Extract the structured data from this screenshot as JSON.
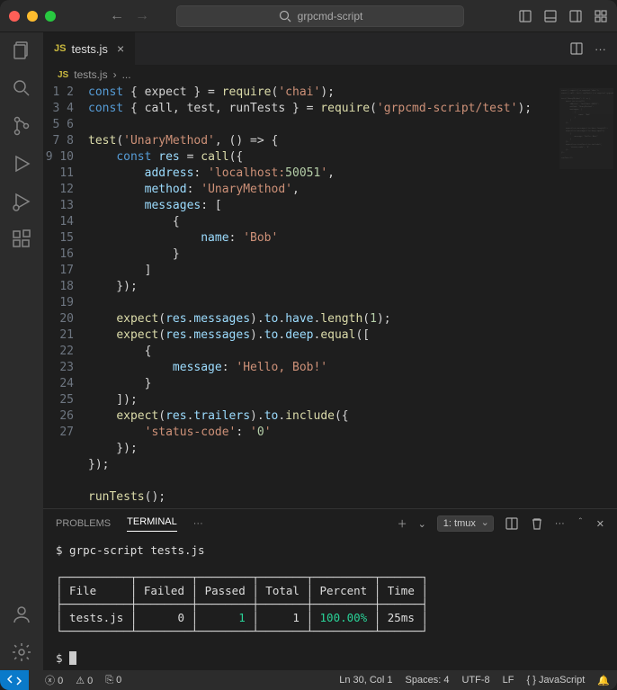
{
  "titlebar": {
    "search_label": "grpcmd-script"
  },
  "tab": {
    "name": "tests.js"
  },
  "breadcrumb": {
    "file": "tests.js",
    "rest": "..."
  },
  "code_lines": [
    "const { expect } = require('chai');",
    "const { call, test, runTests } = require('grpcmd-script/test');",
    "",
    "test('UnaryMethod', () => {",
    "    const res = call({",
    "        address: 'localhost:50051',",
    "        method: 'UnaryMethod',",
    "        messages: [",
    "            {",
    "                name: 'Bob'",
    "            }",
    "        ]",
    "    });",
    "",
    "    expect(res.messages).to.have.length(1);",
    "    expect(res.messages).to.deep.equal([",
    "        {",
    "            message: 'Hello, Bob!'",
    "        }",
    "    ]);",
    "    expect(res.trailers).to.include({",
    "        'status-code': '0'",
    "    });",
    "});",
    "",
    "runTests();",
    ""
  ],
  "panel": {
    "tabs": {
      "problems": "PROBLEMS",
      "terminal": "TERMINAL"
    },
    "term_select": "1: tmux"
  },
  "terminal": {
    "cmd": "$ grpc-script tests.js",
    "headers": [
      "File",
      "Failed",
      "Passed",
      "Total",
      "Percent",
      "Time"
    ],
    "row": [
      "tests.js",
      "0",
      "1",
      "1",
      "100.00%",
      "25ms"
    ],
    "prompt": "$ "
  },
  "status": {
    "errors": "0",
    "warnings": "0",
    "ports": "0",
    "lncol": "Ln 30, Col 1",
    "spaces": "Spaces: 4",
    "encoding": "UTF-8",
    "eol": "LF",
    "lang": "JavaScript",
    "lang_icon": "{ }"
  }
}
